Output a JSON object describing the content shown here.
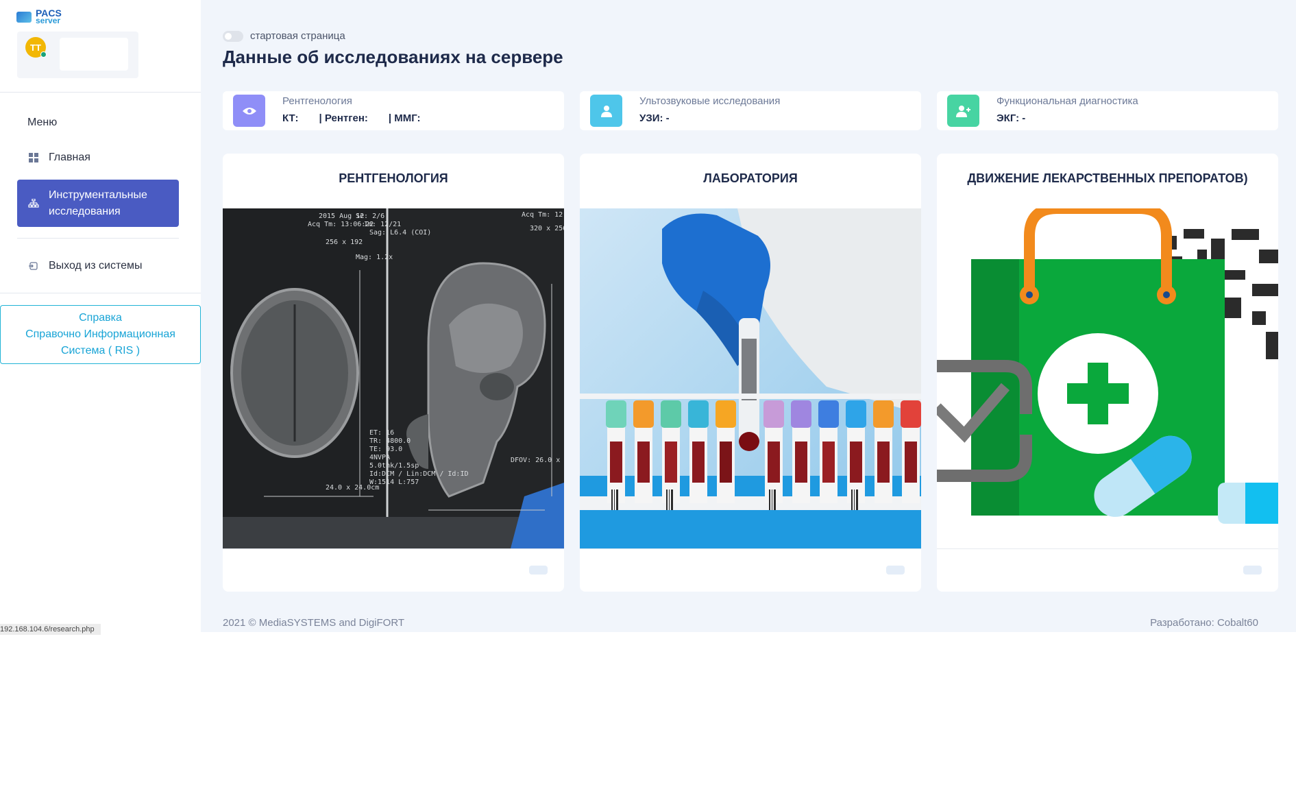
{
  "app": {
    "logo_text_top": "PACS",
    "logo_text_bottom": "server"
  },
  "user": {
    "initials": "TT",
    "status_color": "#1aa37a",
    "avatar_color": "#f2b705"
  },
  "sidebar": {
    "menu_caption": "Меню",
    "items": [
      {
        "label": "Главная",
        "icon": "grid-icon",
        "active": false
      },
      {
        "label": "Инструментальные исследования",
        "icon": "sitemap-icon",
        "active": true
      },
      {
        "label": "Выход из системы",
        "icon": "logout-icon",
        "active": false
      }
    ],
    "help": {
      "line1": "Справка",
      "line2": "Справочно Информационная",
      "line3": "Система ( RIS )"
    },
    "status_url": "192.168.104.6/research.php"
  },
  "main": {
    "start_page_toggle_label": "стартовая страница",
    "start_page_toggle_on": false,
    "title": "Данные об исследованиях на сервере",
    "stats": [
      {
        "label": "Рентгенология",
        "icon": "eye-icon",
        "color": "#8f8ef7",
        "values": [
          "КТ:",
          "| Рентген:",
          "| ММГ:"
        ]
      },
      {
        "label": "Ультозвуковые исследования",
        "icon": "user-icon",
        "color": "#4ec6ea",
        "values": [
          "УЗИ: -"
        ]
      },
      {
        "label": "Функциональная диагностика",
        "icon": "user-plus-icon",
        "color": "#47d4a2",
        "values": [
          "ЭКГ: -"
        ]
      }
    ],
    "panels": [
      {
        "title": "РЕНТГЕНОЛОГИЯ",
        "image": "mri-scan-image"
      },
      {
        "title": "ЛАБОРАТОРИЯ",
        "image": "lab-test-tubes-image"
      },
      {
        "title": "ДВИЖЕНИЕ ЛЕКАРСТВЕННЫХ ПРЕПОРАТОВ)",
        "image": "pharmacy-bag-image"
      }
    ]
  },
  "footer": {
    "copyright": "2021 © MediaSYSTEMS and DigiFORT",
    "developed_by": "Разработано: Cobalt60"
  }
}
